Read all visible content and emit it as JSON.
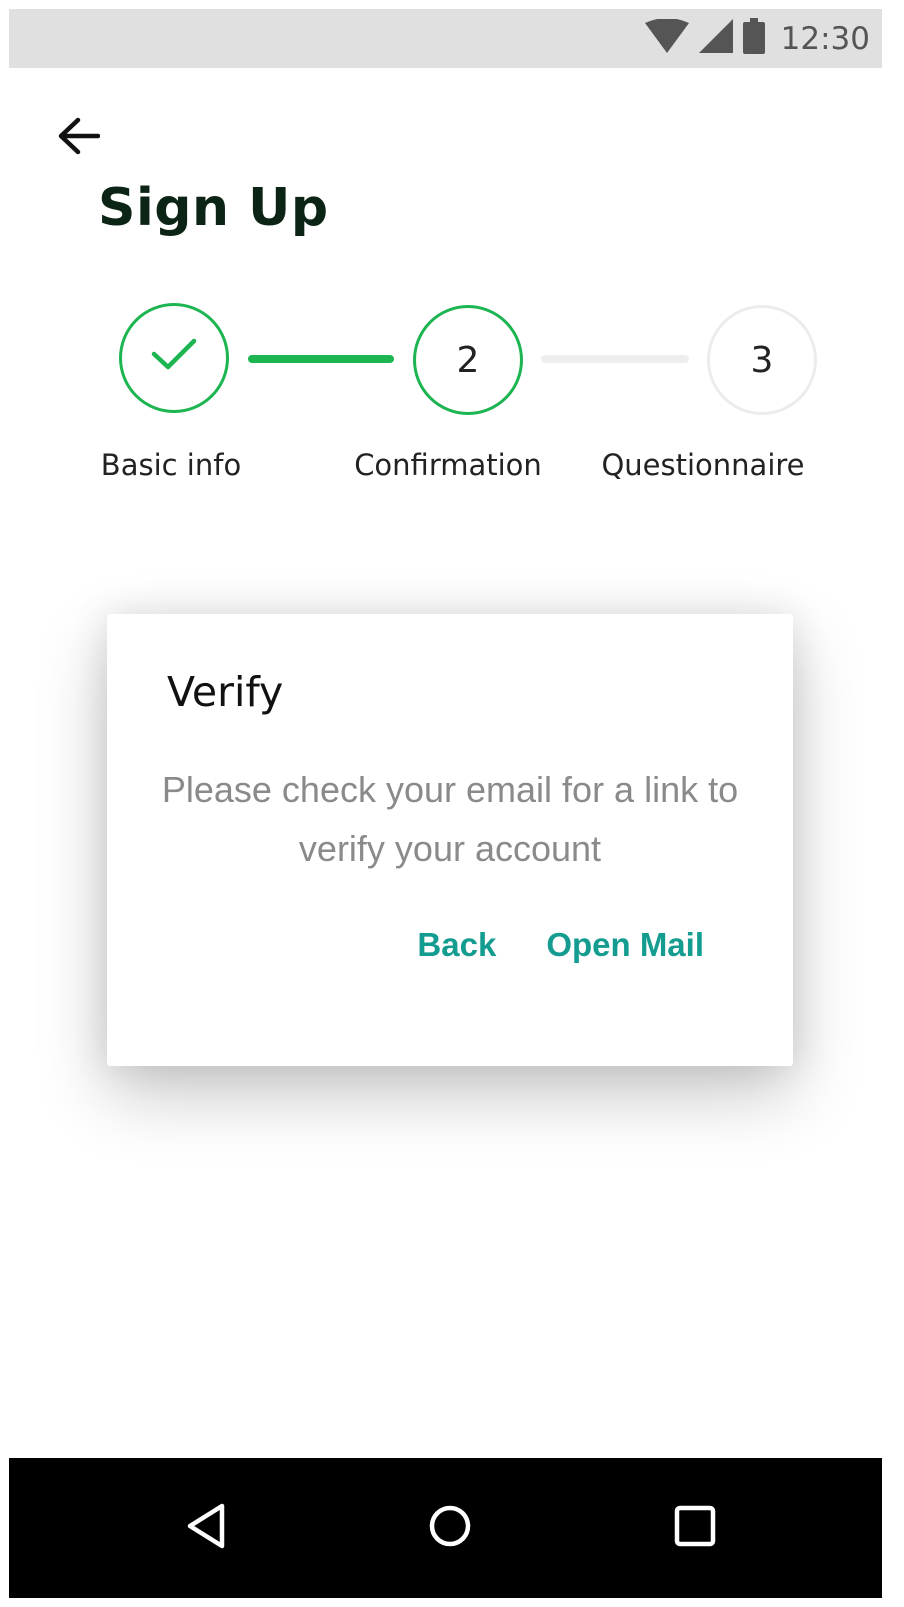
{
  "status_bar": {
    "time": "12:30",
    "icons": [
      "wifi-icon",
      "cell-signal-icon",
      "battery-icon"
    ]
  },
  "header": {
    "title": "Sign Up",
    "back_icon": "arrow-left-icon"
  },
  "stepper": {
    "steps": [
      {
        "label": "Basic info",
        "indicator": "",
        "state": "done",
        "icon": "check-icon"
      },
      {
        "label": "Confirmation",
        "indicator": "2",
        "state": "active"
      },
      {
        "label": "Questionnaire",
        "indicator": "3",
        "state": "pending"
      }
    ]
  },
  "dialog": {
    "title": "Verify",
    "message": "Please check your email for a link to verify your account",
    "actions": {
      "back_label": "Back",
      "open_mail_label": "Open Mail"
    }
  },
  "nav_bar": {
    "icons": [
      "nav-back-icon",
      "nav-home-icon",
      "nav-recents-icon"
    ]
  },
  "colors": {
    "accent_green": "#1cb551",
    "action_teal": "#139c8f",
    "title_dark": "#0c2415"
  }
}
